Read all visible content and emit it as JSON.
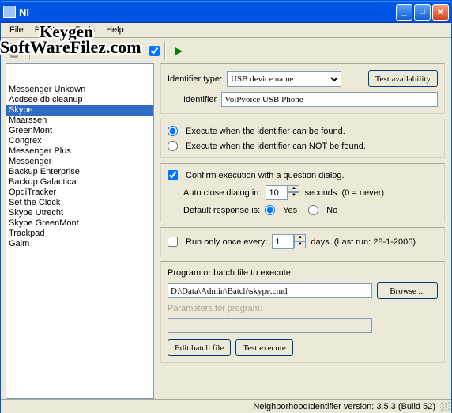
{
  "title": "NI",
  "menu": {
    "file": "File",
    "profiles": "Profiles",
    "tools": "Tools",
    "help": "Help"
  },
  "watermark": {
    "line1": "Keygen",
    "line2": "SoftWareFilez.com"
  },
  "sidebar": {
    "items": [
      "Messenger Unkown",
      "Acdsee db cleanup",
      "Skype",
      "Maarssen",
      "GreenMont",
      "Congrex",
      "Messenger Plus",
      "Messenger",
      "Backup Enterprise",
      "Backup Galactica",
      "OpdiTracker",
      "Set the Clock",
      "Skype Utrecht",
      "Skype GreenMont",
      "Trackpad",
      "Gaim"
    ],
    "selected_index": 2
  },
  "form": {
    "identifier_type_label": "Identifier type:",
    "identifier_type_value": "USB device name",
    "test_availability": "Test availability",
    "identifier_label": "Identifier",
    "identifier_value": "VoiPvoice USB Phone",
    "exec_found": "Execute when the identifier can be found.",
    "exec_not_found": "Execute when the identifier can NOT be found.",
    "confirm_label": "Confirm execution with a question dialog.",
    "auto_close_label": "Auto close dialog in:",
    "auto_close_value": "10",
    "auto_close_suffix": "seconds.  (0 = never)",
    "default_response_label": "Default response is:",
    "yes": "Yes",
    "no": "No",
    "run_once_label": "Run only once every:",
    "run_once_value": "1",
    "run_once_suffix": "days.   (Last run: 28-1-2006)",
    "program_label": "Program or batch file to execute:",
    "program_value": "D:\\Data\\Admin\\Batch\\skype.cmd",
    "browse": "Browse ...",
    "params_label": "Parameters for program:",
    "params_value": "",
    "edit_batch": "Edit batch file",
    "test_execute": "Test execute"
  },
  "status": "NeighborhoodIdentifier version: 3.5.3 (Build 52)"
}
